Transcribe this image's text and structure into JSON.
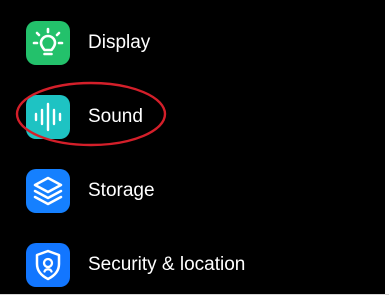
{
  "settings": {
    "items": [
      {
        "label": "Display",
        "icon": "display-brightness-icon",
        "icon_color": "#23c16b"
      },
      {
        "label": "Sound",
        "icon": "sound-waveform-icon",
        "icon_color": "#1ec3c3"
      },
      {
        "label": "Storage",
        "icon": "storage-layers-icon",
        "icon_color": "#1580ff"
      },
      {
        "label": "Security & location",
        "icon": "security-shield-icon",
        "icon_color": "#1276ff"
      }
    ]
  },
  "highlight": {
    "target": "Sound",
    "color": "#d41f2a"
  }
}
